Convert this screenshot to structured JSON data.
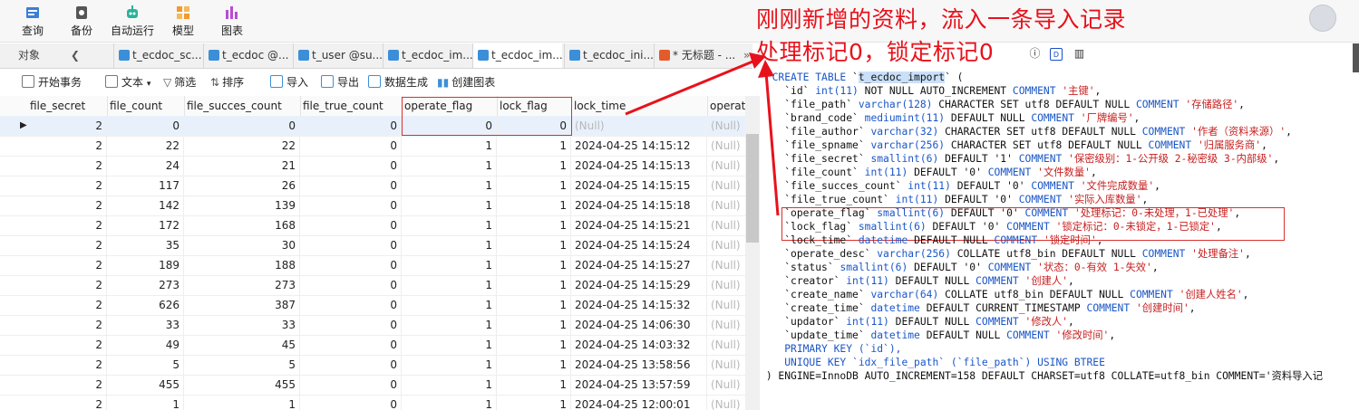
{
  "toolbar": {
    "buttons": [
      {
        "label": "查询"
      },
      {
        "label": "备份"
      },
      {
        "label": "自动运行"
      },
      {
        "label": "模型"
      },
      {
        "label": "图表"
      }
    ]
  },
  "tabs": {
    "objects_label": "对象",
    "items": [
      {
        "label": "t_ecdoc_sc..."
      },
      {
        "label": "t_ecdoc @..."
      },
      {
        "label": "t_user @su..."
      },
      {
        "label": "t_ecdoc_im..."
      },
      {
        "label": "t_ecdoc_im...",
        "active": true
      },
      {
        "label": "t_ecdoc_ini..."
      },
      {
        "label": "* 无标题 - ..."
      }
    ],
    "more": "»"
  },
  "grid_toolbar": {
    "begin_transaction": "开始事务",
    "text": "文本",
    "filter": "筛选",
    "sort": "排序",
    "import": "导入",
    "export": "导出",
    "data_gen": "数据生成",
    "create_chart": "创建图表"
  },
  "grid": {
    "columns": [
      "file_secret",
      "file_count",
      "file_succes_count",
      "file_true_count",
      "operate_flag",
      "lock_flag",
      "lock_time",
      "operat"
    ],
    "null_text": "(Null)",
    "rows": [
      [
        "2",
        "0",
        "0",
        "0",
        "0",
        "0",
        "(Null)",
        "(Null)"
      ],
      [
        "2",
        "22",
        "22",
        "0",
        "1",
        "1",
        "2024-04-25 14:15:12",
        "(Null)"
      ],
      [
        "2",
        "24",
        "21",
        "0",
        "1",
        "1",
        "2024-04-25 14:15:13",
        "(Null)"
      ],
      [
        "2",
        "117",
        "26",
        "0",
        "1",
        "1",
        "2024-04-25 14:15:15",
        "(Null)"
      ],
      [
        "2",
        "142",
        "139",
        "0",
        "1",
        "1",
        "2024-04-25 14:15:18",
        "(Null)"
      ],
      [
        "2",
        "172",
        "168",
        "0",
        "1",
        "1",
        "2024-04-25 14:15:21",
        "(Null)"
      ],
      [
        "2",
        "35",
        "30",
        "0",
        "1",
        "1",
        "2024-04-25 14:15:24",
        "(Null)"
      ],
      [
        "2",
        "189",
        "188",
        "0",
        "1",
        "1",
        "2024-04-25 14:15:27",
        "(Null)"
      ],
      [
        "2",
        "273",
        "273",
        "0",
        "1",
        "1",
        "2024-04-25 14:15:29",
        "(Null)"
      ],
      [
        "2",
        "626",
        "387",
        "0",
        "1",
        "1",
        "2024-04-25 14:15:32",
        "(Null)"
      ],
      [
        "2",
        "33",
        "33",
        "0",
        "1",
        "1",
        "2024-04-25 14:06:30",
        "(Null)"
      ],
      [
        "2",
        "49",
        "45",
        "0",
        "1",
        "1",
        "2024-04-25 14:03:32",
        "(Null)"
      ],
      [
        "2",
        "5",
        "5",
        "0",
        "1",
        "1",
        "2024-04-25 13:58:56",
        "(Null)"
      ],
      [
        "2",
        "455",
        "455",
        "0",
        "1",
        "1",
        "2024-04-25 13:57:59",
        "(Null)"
      ],
      [
        "2",
        "1",
        "1",
        "0",
        "1",
        "1",
        "2024-04-25 12:00:01",
        "(Null)"
      ]
    ]
  },
  "annotation": {
    "line1": "刚刚新增的资料，流入一条导入记录",
    "line2": "处理标记0，锁定标记0",
    "color": "#e8111b"
  },
  "ddl": {
    "create_table": "CREATE TABLE",
    "table_name": "t_ecdoc_import",
    "lines": [
      {
        "col": "`id`",
        "type": "int(11)",
        "rest": "NOT NULL AUTO_INCREMENT",
        "comment_kw": "COMMENT",
        "comment": "'主键'",
        "tail": ","
      },
      {
        "col": "`file_path`",
        "type": "varchar(128)",
        "rest": "CHARACTER SET utf8 DEFAULT NULL",
        "comment_kw": "COMMENT",
        "comment": "'存储路径'",
        "tail": ","
      },
      {
        "col": "`brand_code`",
        "type": "mediumint(11)",
        "rest": "DEFAULT NULL",
        "comment_kw": "COMMENT",
        "comment": "'厂牌编号'",
        "tail": ","
      },
      {
        "col": "`file_author`",
        "type": "varchar(32)",
        "rest": "CHARACTER SET utf8 DEFAULT NULL",
        "comment_kw": "COMMENT",
        "comment": "'作者（资料来源）'",
        "tail": ","
      },
      {
        "col": "`file_spname`",
        "type": "varchar(256)",
        "rest": "CHARACTER SET utf8 DEFAULT NULL",
        "comment_kw": "COMMENT",
        "comment": "'归属服务商'",
        "tail": ","
      },
      {
        "col": "`file_secret`",
        "type": "smallint(6)",
        "rest": "DEFAULT '1'",
        "comment_kw": "COMMENT",
        "comment": "'保密级别：1-公开级 2-秘密级 3-内部级'",
        "tail": ","
      },
      {
        "col": "`file_count`",
        "type": "int(11)",
        "rest": "DEFAULT '0'",
        "comment_kw": "COMMENT",
        "comment": "'文件数量'",
        "tail": ","
      },
      {
        "col": "`file_succes_count`",
        "type": "int(11)",
        "rest": "DEFAULT '0'",
        "comment_kw": "COMMENT",
        "comment": "'文件完成数量'",
        "tail": ","
      },
      {
        "col": "`file_true_count`",
        "type": "int(11)",
        "rest": "DEFAULT '0'",
        "comment_kw": "COMMENT",
        "comment": "'实际入库数量'",
        "tail": ","
      },
      {
        "col": "`operate_flag`",
        "type": "smallint(6)",
        "rest": "DEFAULT '0'",
        "comment_kw": "COMMENT",
        "comment": "'处理标记：0-未处理，1-已处理'",
        "tail": ","
      },
      {
        "col": "`lock_flag`",
        "type": "smallint(6)",
        "rest": "DEFAULT '0'",
        "comment_kw": "COMMENT",
        "comment": "'锁定标记：0-未锁定，1-已锁定'",
        "tail": ","
      },
      {
        "col": "`lock_time`",
        "type": "datetime",
        "rest": "DEFAULT NULL",
        "comment_kw": "COMMENT",
        "comment": "'锁定时间'",
        "tail": ","
      },
      {
        "col": "`operate_desc`",
        "type": "varchar(256)",
        "rest": "COLLATE utf8_bin DEFAULT NULL",
        "comment_kw": "COMMENT",
        "comment": "'处理备注'",
        "tail": ","
      },
      {
        "col": "`status`",
        "type": "smallint(6)",
        "rest": "DEFAULT '0'",
        "comment_kw": "COMMENT",
        "comment": "'状态：0-有效 1-失效'",
        "tail": ","
      },
      {
        "col": "`creator`",
        "type": "int(11)",
        "rest": "DEFAULT NULL",
        "comment_kw": "COMMENT",
        "comment": "'创建人'",
        "tail": ","
      },
      {
        "col": "`create_name`",
        "type": "varchar(64)",
        "rest": "COLLATE utf8_bin DEFAULT NULL",
        "comment_kw": "COMMENT",
        "comment": "'创建人姓名'",
        "tail": ","
      },
      {
        "col": "`create_time`",
        "type": "datetime",
        "rest": "DEFAULT CURRENT_TIMESTAMP",
        "comment_kw": "COMMENT",
        "comment": "'创建时间'",
        "tail": ","
      },
      {
        "col": "`updator`",
        "type": "int(11)",
        "rest": "DEFAULT NULL",
        "comment_kw": "COMMENT",
        "comment": "'修改人'",
        "tail": ","
      },
      {
        "col": "`update_time`",
        "type": "datetime",
        "rest": "DEFAULT NULL",
        "comment_kw": "COMMENT",
        "comment": "'修改时间'",
        "tail": ","
      }
    ],
    "primary_key": "PRIMARY KEY (`id`),",
    "unique_key": "UNIQUE KEY `idx_file_path` (`file_path`) USING BTREE",
    "engine_line": ") ENGINE=InnoDB AUTO_INCREMENT=158 DEFAULT CHARSET=utf8 COLLATE=utf8_bin COMMENT='资料导入记"
  }
}
